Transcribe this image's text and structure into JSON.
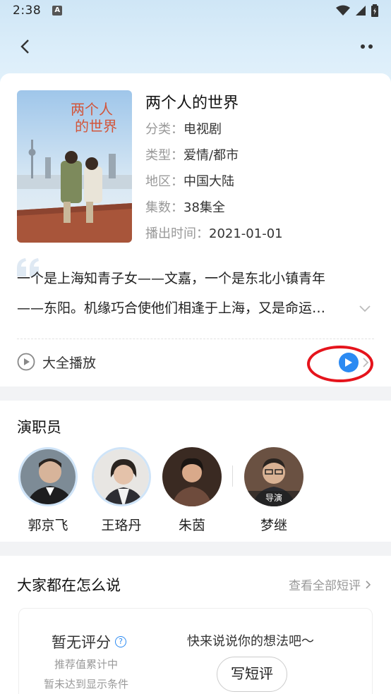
{
  "status_bar": {
    "time": "2:38",
    "notification": "A"
  },
  "show": {
    "title": "两个人的世界",
    "poster_title": "两个人的世界",
    "fields": [
      {
        "key": "分类：",
        "value": "电视剧"
      },
      {
        "key": "类型：",
        "value": "爱情/都市"
      },
      {
        "key": "地区：",
        "value": "中国大陆"
      },
      {
        "key": "集数：",
        "value": "38集全"
      },
      {
        "key": "播出时间：",
        "value": "2021-01-01"
      }
    ],
    "description_line1": "一个是上海知青子女——文嘉，一个是东北小镇青年",
    "description_line2": "——东阳。机缘巧合使他们相逢于上海，又是命运…",
    "play_all_label": "大全播放"
  },
  "cast": {
    "section_title": "演职员",
    "members": [
      {
        "name": "郭京飞",
        "role": ""
      },
      {
        "name": "王珞丹",
        "role": ""
      },
      {
        "name": "朱茵",
        "role": ""
      },
      {
        "name": "梦继",
        "role": "导演"
      }
    ]
  },
  "reviews": {
    "section_title": "大家都在怎么说",
    "see_all": "查看全部短评",
    "no_score": "暂无评分",
    "note_line1": "推荐值累计中",
    "note_line2": "暂未达到显示条件",
    "prompt": "快来说说你的想法吧～",
    "write_button": "写短评"
  },
  "colors": {
    "accent": "#2b8af2",
    "highlight": "#e5141c"
  }
}
